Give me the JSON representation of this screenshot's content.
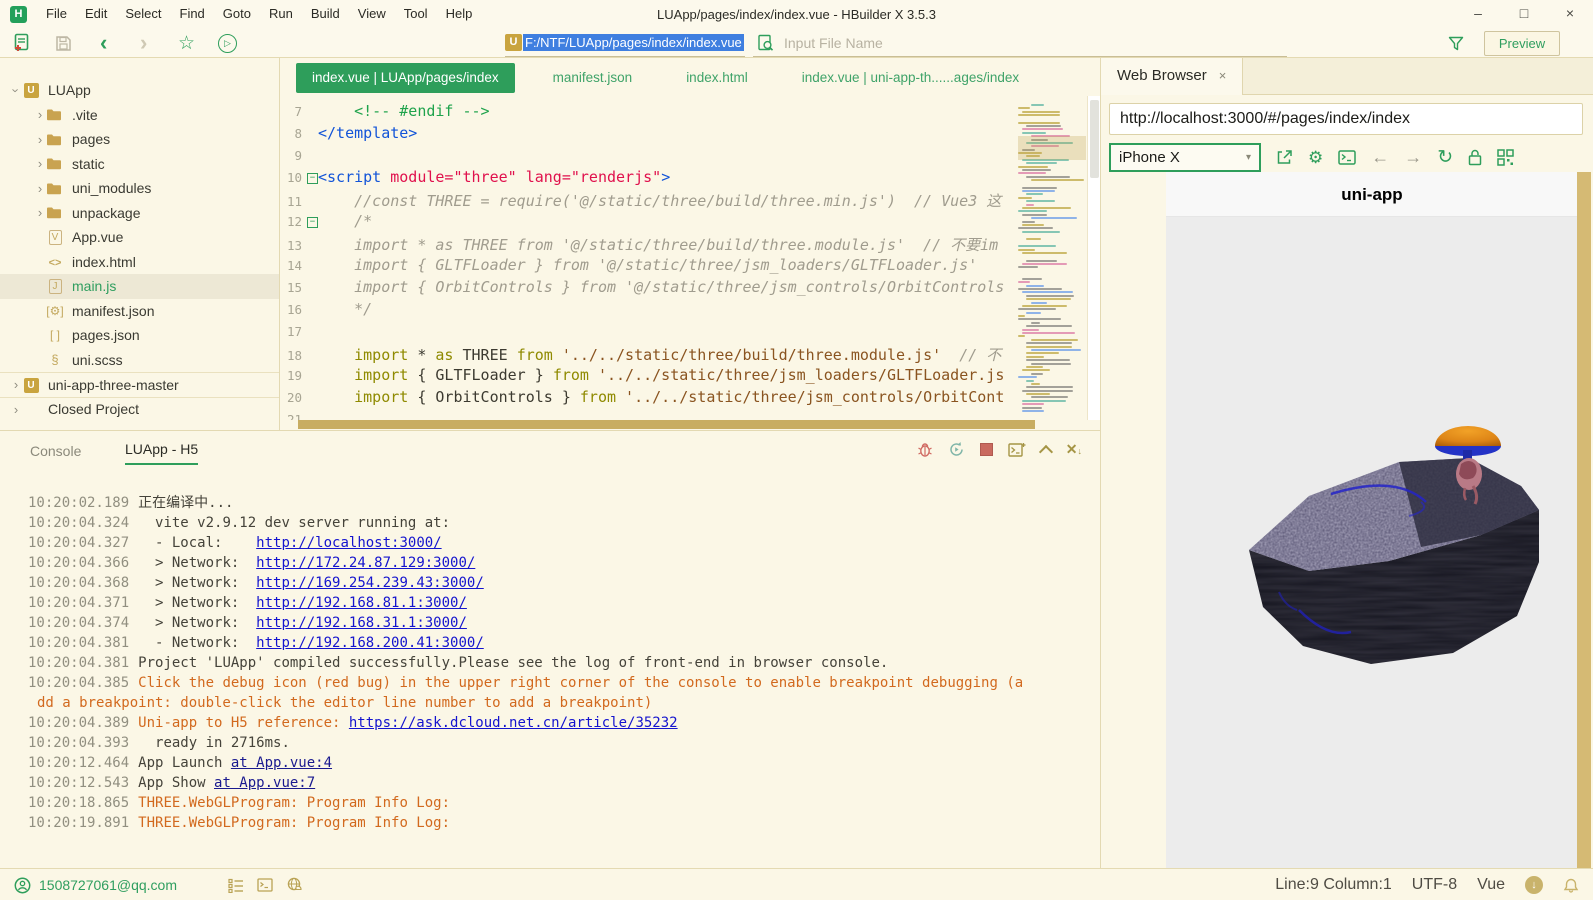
{
  "colors": {
    "accent_green": "#2E9E5B",
    "cream_bg": "#FBF7E6",
    "tab_active": "#2E9E5B",
    "console_orange": "#D2691E",
    "link_blue": "#1414CE",
    "gold_scrollbar": "#D5BA74",
    "selection_blue": "#3F7FE0",
    "app_icon_gold": "#C9A43F"
  },
  "titlebar": {
    "app_logo": "H",
    "menus": [
      "File",
      "Edit",
      "Select",
      "Find",
      "Goto",
      "Run",
      "Build",
      "View",
      "Tool",
      "Help"
    ],
    "title": "LUApp/pages/index/index.vue - HBuilder X 3.5.3",
    "window_buttons": [
      "minimize",
      "maximize",
      "close"
    ],
    "minimize_glyph": "–",
    "maximize_glyph": "□",
    "close_glyph": "×"
  },
  "toolbar": {
    "icons": [
      "new-file-icon",
      "save-icon",
      "back-icon",
      "forward-icon",
      "star-icon",
      "run-icon"
    ],
    "back_glyph": "‹",
    "forward_glyph": "›",
    "star_glyph": "☆",
    "address_icon": "U",
    "address": "F:/NTF/LUApp/pages/index/index.vue",
    "search_placeholder": "Input File Name",
    "preview_label": "Preview"
  },
  "sidebar": {
    "items": [
      {
        "label": "LUApp",
        "icon": "app",
        "chevron": "down",
        "depth": 0
      },
      {
        "label": ".vite",
        "icon": "folder",
        "chevron": "right",
        "depth": 1
      },
      {
        "label": "pages",
        "icon": "folder",
        "chevron": "right",
        "depth": 1
      },
      {
        "label": "static",
        "icon": "folder",
        "chevron": "right",
        "depth": 1
      },
      {
        "label": "uni_modules",
        "icon": "folder",
        "chevron": "right",
        "depth": 1
      },
      {
        "label": "unpackage",
        "icon": "folder",
        "chevron": "right",
        "depth": 1
      },
      {
        "label": "App.vue",
        "icon": "vue",
        "chevron": "none",
        "depth": 1
      },
      {
        "label": "index.html",
        "icon": "html",
        "chevron": "none",
        "depth": 1
      },
      {
        "label": "main.js",
        "icon": "js",
        "chevron": "none",
        "depth": 1,
        "selected": true
      },
      {
        "label": "manifest.json",
        "icon": "json-gear",
        "chevron": "none",
        "depth": 1
      },
      {
        "label": "pages.json",
        "icon": "json-brackets",
        "chevron": "none",
        "depth": 1
      },
      {
        "label": "uni.scss",
        "icon": "scss",
        "chevron": "none",
        "depth": 1
      },
      {
        "label": "uni-app-three-master",
        "icon": "app",
        "chevron": "right",
        "depth": 0,
        "separator": true
      },
      {
        "label": "Closed Project",
        "icon": "none",
        "chevron": "right",
        "depth": 0,
        "separator": true
      }
    ]
  },
  "editor": {
    "tabs": [
      {
        "label": "index.vue | LUApp/pages/index",
        "active": true
      },
      {
        "label": "manifest.json",
        "active": false
      },
      {
        "label": "index.html",
        "active": false
      },
      {
        "label": "index.vue | uni-app-th......ages/index",
        "active": false
      }
    ],
    "lines": [
      {
        "n": 7,
        "seg": [
          [
            "cmtg",
            "    <!-- #endif -->"
          ]
        ]
      },
      {
        "n": 8,
        "seg": [
          [
            "tag",
            "</template>"
          ]
        ]
      },
      {
        "n": 9,
        "seg": []
      },
      {
        "n": 10,
        "fold": true,
        "seg": [
          [
            "tag",
            "<script"
          ],
          [
            "attr",
            " module="
          ],
          [
            "attr",
            "\"three\""
          ],
          [
            "attr",
            " lang="
          ],
          [
            "attr",
            "\"renderjs\""
          ],
          [
            "tag",
            ">"
          ]
        ]
      },
      {
        "n": 11,
        "seg": [
          [
            "cmti",
            "    //const THREE = require('@/static/three/build/three.min.js')  // Vue3 这"
          ]
        ]
      },
      {
        "n": 12,
        "fold": true,
        "seg": [
          [
            "cmti",
            "    /*"
          ]
        ]
      },
      {
        "n": 13,
        "seg": [
          [
            "cmti",
            "    import * as THREE from '@/static/three/build/three.module.js'  // 不要im"
          ]
        ]
      },
      {
        "n": 14,
        "seg": [
          [
            "cmti",
            "    import { GLTFLoader } from '@/static/three/jsm_loaders/GLTFLoader.js'"
          ]
        ]
      },
      {
        "n": 15,
        "seg": [
          [
            "cmti",
            "    import { OrbitControls } from '@/static/three/jsm_controls/OrbitControls"
          ]
        ]
      },
      {
        "n": 16,
        "seg": [
          [
            "cmti",
            "    */"
          ]
        ]
      },
      {
        "n": 17,
        "seg": []
      },
      {
        "n": 18,
        "seg": [
          [
            "kw",
            "    import"
          ],
          [
            "plain",
            " * "
          ],
          [
            "kw",
            "as"
          ],
          [
            "plain",
            " THREE "
          ],
          [
            "kw",
            "from"
          ],
          [
            "str",
            " '../../static/three/build/three.module.js'"
          ],
          [
            "cmti",
            "  // 不"
          ]
        ]
      },
      {
        "n": 19,
        "seg": [
          [
            "kw",
            "    import"
          ],
          [
            "plain",
            " { GLTFLoader } "
          ],
          [
            "kw",
            "from"
          ],
          [
            "str",
            " '../../static/three/jsm_loaders/GLTFLoader.js"
          ]
        ]
      },
      {
        "n": 20,
        "seg": [
          [
            "kw",
            "    import"
          ],
          [
            "plain",
            " { OrbitControls } "
          ],
          [
            "kw",
            "from"
          ],
          [
            "str",
            " '../../static/three/jsm_controls/OrbitCont"
          ]
        ]
      },
      {
        "n": 21,
        "seg": []
      }
    ]
  },
  "console": {
    "label": "Console",
    "tab": "LUApp - H5",
    "icons": [
      "debug-bug-icon",
      "restart-icon",
      "stop-icon",
      "new-terminal-icon",
      "collapse-icon",
      "clear-icon"
    ],
    "lines": [
      {
        "t": "10:20:02.189",
        "seg": [
          [
            "p",
            "正在编译中..."
          ]
        ]
      },
      {
        "t": "10:20:04.324",
        "seg": [
          [
            "p",
            "  vite v2.9.12 dev server running at:"
          ]
        ]
      },
      {
        "t": "10:20:04.327",
        "seg": [
          [
            "p",
            "  - Local:    "
          ],
          [
            "l",
            "http://localhost:3000/"
          ]
        ]
      },
      {
        "t": "10:20:04.366",
        "seg": [
          [
            "p",
            "  > Network:  "
          ],
          [
            "l",
            "http://172.24.87.129:3000/"
          ]
        ]
      },
      {
        "t": "10:20:04.368",
        "seg": [
          [
            "p",
            "  > Network:  "
          ],
          [
            "l",
            "http://169.254.239.43:3000/"
          ]
        ]
      },
      {
        "t": "10:20:04.371",
        "seg": [
          [
            "p",
            "  > Network:  "
          ],
          [
            "l",
            "http://192.168.81.1:3000/"
          ]
        ]
      },
      {
        "t": "10:20:04.374",
        "seg": [
          [
            "p",
            "  > Network:  "
          ],
          [
            "l",
            "http://192.168.31.1:3000/"
          ]
        ]
      },
      {
        "t": "10:20:04.381",
        "seg": [
          [
            "p",
            "  - Network:  "
          ],
          [
            "l",
            "http://192.168.200.41:3000/"
          ]
        ]
      },
      {
        "t": "10:20:04.381",
        "seg": [
          [
            "p",
            "Project 'LUApp' compiled successfully.Please see the log of front-end in browser console."
          ]
        ]
      },
      {
        "t": "10:20:04.385",
        "seg": [
          [
            "o",
            "Click the debug icon (red bug) in the upper right corner of the console to enable breakpoint debugging (a"
          ]
        ]
      },
      {
        "t": "",
        "seg": [
          [
            "o",
            "dd a breakpoint: double-click the editor line number to add a breakpoint)"
          ]
        ]
      },
      {
        "t": "10:20:04.389",
        "seg": [
          [
            "o",
            "Uni-app to H5 reference: "
          ],
          [
            "l",
            "https://ask.dcloud.net.cn/article/35232"
          ]
        ]
      },
      {
        "t": "10:20:04.393",
        "seg": [
          [
            "p",
            "  ready in 2716ms."
          ]
        ]
      },
      {
        "t": "10:20:12.464",
        "seg": [
          [
            "p",
            "App Launch "
          ],
          [
            "n",
            "at App.vue:4"
          ]
        ]
      },
      {
        "t": "10:20:12.543",
        "seg": [
          [
            "p",
            "App Show "
          ],
          [
            "n",
            "at App.vue:7"
          ]
        ]
      },
      {
        "t": "10:20:18.865",
        "seg": [
          [
            "o",
            "THREE.WebGLProgram: Program Info Log:"
          ]
        ]
      },
      {
        "t": "10:20:19.891",
        "seg": [
          [
            "o",
            "THREE.WebGLProgram: Program Info Log:"
          ]
        ]
      }
    ]
  },
  "browser": {
    "tab": "Web Browser",
    "close_glyph": "×",
    "url": "http://localhost:3000/#/pages/index/index",
    "device": "iPhone X",
    "device_caret": "▾",
    "icons": [
      "open-external-icon",
      "gear-icon",
      "terminal-icon",
      "back-arrow-icon",
      "forward-arrow-icon",
      "refresh-icon",
      "lock-icon",
      "qrcode-icon"
    ],
    "gear_glyph": "⚙",
    "refresh_glyph": "↻",
    "back_glyph": "←",
    "forward_glyph": "→",
    "page_title": "uni-app"
  },
  "statusbar": {
    "account": "1508727061@qq.com",
    "icons": [
      "account-icon",
      "todo-list-icon",
      "terminal-icon",
      "globe-icon",
      "update-download-icon",
      "notification-bell-icon"
    ],
    "line_col": "Line:9 Column:1",
    "encoding": "UTF-8",
    "mode": "Vue",
    "download_glyph": "↓"
  }
}
